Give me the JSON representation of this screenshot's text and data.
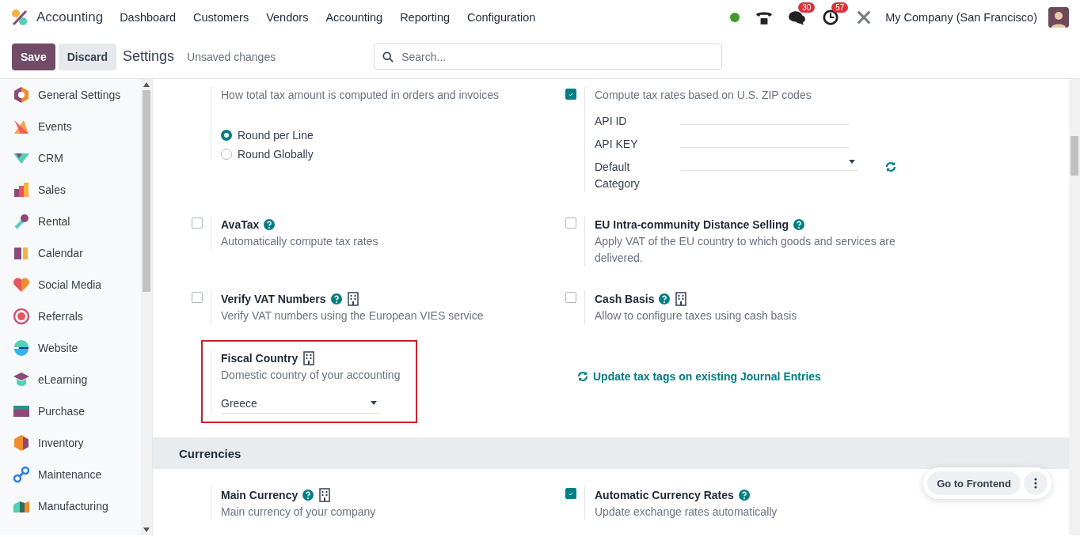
{
  "navbar": {
    "app_name": "Accounting",
    "menus": [
      "Dashboard",
      "Customers",
      "Vendors",
      "Accounting",
      "Reporting",
      "Configuration"
    ],
    "systray": {
      "messages_badge": "30",
      "activities_badge": "57",
      "company": "My Company (San Francisco)"
    }
  },
  "control_panel": {
    "save": "Save",
    "discard": "Discard",
    "breadcrumb": "Settings",
    "status": "Unsaved changes",
    "search": {
      "placeholder": "Search..."
    }
  },
  "sidebar": {
    "items": [
      {
        "label": "General Settings",
        "selected": false
      },
      {
        "label": "Events",
        "selected": false
      },
      {
        "label": "CRM",
        "selected": false
      },
      {
        "label": "Sales",
        "selected": false
      },
      {
        "label": "Rental",
        "selected": false
      },
      {
        "label": "Calendar",
        "selected": false
      },
      {
        "label": "Social Media",
        "selected": false
      },
      {
        "label": "Referrals",
        "selected": false
      },
      {
        "label": "Website",
        "selected": false
      },
      {
        "label": "eLearning",
        "selected": false
      },
      {
        "label": "Purchase",
        "selected": false
      },
      {
        "label": "Inventory",
        "selected": false
      },
      {
        "label": "Maintenance",
        "selected": false
      },
      {
        "label": "Manufacturing",
        "selected": false
      }
    ]
  },
  "settings": [
    {
      "kind": "row",
      "left": {
        "kind": "plain",
        "description": "How total tax amount is computed in orders and invoices",
        "options": [
          {
            "label": "Round per Line",
            "selected": true
          },
          {
            "label": "Round Globally",
            "selected": false
          }
        ]
      },
      "right": {
        "kind": "checkbox",
        "checked": true,
        "description": "Compute tax rates based on U.S. ZIP codes",
        "fields": [
          {
            "label": "API ID",
            "kind": "text"
          },
          {
            "label": "API KEY",
            "kind": "text"
          },
          {
            "label": "Default Category",
            "kind": "select",
            "refresh": true
          }
        ]
      }
    },
    {
      "kind": "row",
      "left": {
        "kind": "checkbox",
        "checked": false,
        "title": "AvaTax",
        "help": true,
        "company": false,
        "description": "Automatically compute tax rates"
      },
      "right": {
        "kind": "checkbox",
        "checked": false,
        "title": "EU Intra-community Distance Selling",
        "help": true,
        "company": false,
        "description": "Apply VAT of the EU country to which goods and services are delivered."
      }
    },
    {
      "kind": "row",
      "left": {
        "kind": "checkbox",
        "checked": false,
        "title": "Verify VAT Numbers",
        "help": true,
        "company": true,
        "description": "Verify VAT numbers using the European VIES service"
      },
      "right": {
        "kind": "checkbox",
        "checked": false,
        "title": "Cash Basis",
        "help": true,
        "company": true,
        "description": "Allow to configure taxes using cash basis"
      }
    },
    {
      "kind": "row",
      "left": {
        "kind": "plain",
        "title": "Fiscal Country",
        "help": false,
        "company": true,
        "highlighted": true,
        "description": "Domestic country of your accounting",
        "select": {
          "value": "Greece"
        }
      },
      "right": {
        "kind": "link",
        "label": "Update tax tags on existing Journal Entries"
      }
    },
    {
      "kind": "section",
      "title": "Currencies"
    },
    {
      "kind": "row",
      "left": {
        "kind": "plain",
        "title": "Main Currency",
        "help": true,
        "company": true,
        "description": "Main currency of your company"
      },
      "right": {
        "kind": "checkbox",
        "checked": true,
        "title": "Automatic Currency Rates",
        "help": true,
        "company": false,
        "description": "Update exchange rates automatically"
      }
    }
  ],
  "floating": {
    "label": "Go to Frontend"
  }
}
